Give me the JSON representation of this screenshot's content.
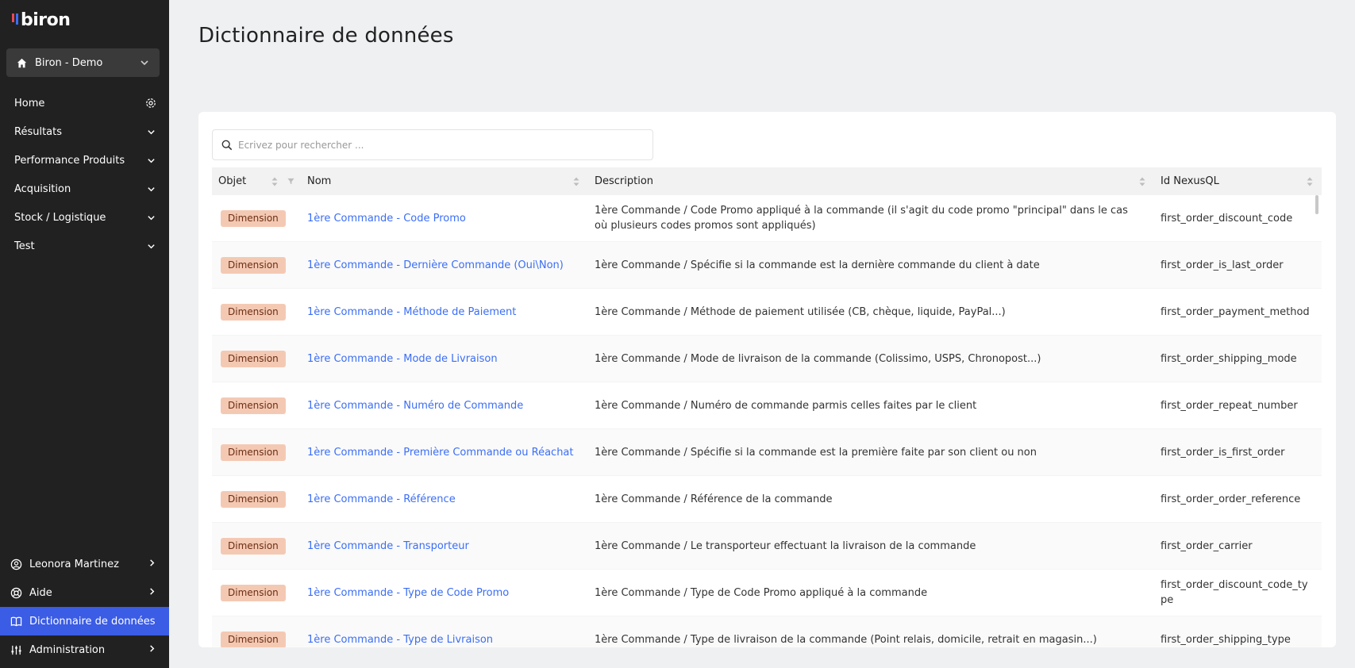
{
  "app": {
    "logo_text": "biron"
  },
  "sidebar": {
    "workspace": {
      "label": "Biron - Demo"
    },
    "items": [
      {
        "label": "Home",
        "icon": "gear-icon"
      },
      {
        "label": "Résultats",
        "icon": "chevron-down-icon"
      },
      {
        "label": "Performance Produits",
        "icon": "chevron-down-icon"
      },
      {
        "label": "Acquisition",
        "icon": "chevron-down-icon"
      },
      {
        "label": "Stock / Logistique",
        "icon": "chevron-down-icon"
      },
      {
        "label": "Test",
        "icon": "chevron-down-icon"
      }
    ],
    "bottom": [
      {
        "label": "Leonora Martinez",
        "icon": "user-circle-icon"
      },
      {
        "label": "Aide",
        "icon": "help-lifebuoy-icon"
      },
      {
        "label": "Dictionnaire de données",
        "icon": "book-icon",
        "active": true
      },
      {
        "label": "Administration",
        "icon": "sliders-icon"
      }
    ]
  },
  "page": {
    "title": "Dictionnaire de données"
  },
  "search": {
    "placeholder": "Ecrivez pour rechercher ..."
  },
  "table": {
    "columns": [
      "Objet",
      "Nom",
      "Description",
      "Id NexusQL"
    ],
    "rows": [
      {
        "objet": "Dimension",
        "nom": "1ère Commande - Code Promo",
        "description": "1ère Commande / Code Promo appliqué à la commande (il s'agit du code promo \"principal\" dans le cas où plusieurs codes promos sont appliqués)",
        "id": "first_order_discount_code"
      },
      {
        "objet": "Dimension",
        "nom": "1ère Commande - Dernière Commande (Oui\\Non)",
        "description": "1ère Commande / Spécifie si la commande est la dernière commande du client à date",
        "id": "first_order_is_last_order"
      },
      {
        "objet": "Dimension",
        "nom": "1ère Commande - Méthode de Paiement",
        "description": "1ère Commande / Méthode de paiement utilisée (CB, chèque, liquide, PayPal...)",
        "id": "first_order_payment_method"
      },
      {
        "objet": "Dimension",
        "nom": "1ère Commande - Mode de Livraison",
        "description": "1ère Commande / Mode de livraison de la commande (Colissimo, USPS, Chronopost...)",
        "id": "first_order_shipping_mode"
      },
      {
        "objet": "Dimension",
        "nom": "1ère Commande - Numéro de Commande",
        "description": "1ère Commande / Numéro de commande parmis celles faites par le client",
        "id": "first_order_repeat_number"
      },
      {
        "objet": "Dimension",
        "nom": "1ère Commande - Première Commande ou Réachat",
        "description": "1ère Commande / Spécifie si la commande est la première faite par son client ou non",
        "id": "first_order_is_first_order"
      },
      {
        "objet": "Dimension",
        "nom": "1ère Commande - Référence",
        "description": "1ère Commande / Référence de la commande",
        "id": "first_order_order_reference"
      },
      {
        "objet": "Dimension",
        "nom": "1ère Commande - Transporteur",
        "description": "1ère Commande / Le transporteur effectuant la livraison de la commande",
        "id": "first_order_carrier"
      },
      {
        "objet": "Dimension",
        "nom": "1ère Commande - Type de Code Promo",
        "description": "1ère Commande / Type de Code Promo appliqué à la commande",
        "id": "first_order_discount_code_type"
      },
      {
        "objet": "Dimension",
        "nom": "1ère Commande - Type de Livraison",
        "description": "1ère Commande / Type de livraison de la commande (Point relais, domicile, retrait en magasin...)",
        "id": "first_order_shipping_type"
      }
    ]
  },
  "colors": {
    "sidebar_bg": "#212121",
    "active": "#3b5ce4",
    "link": "#3b6ef5",
    "badge_bg": "#f4c9b3"
  }
}
